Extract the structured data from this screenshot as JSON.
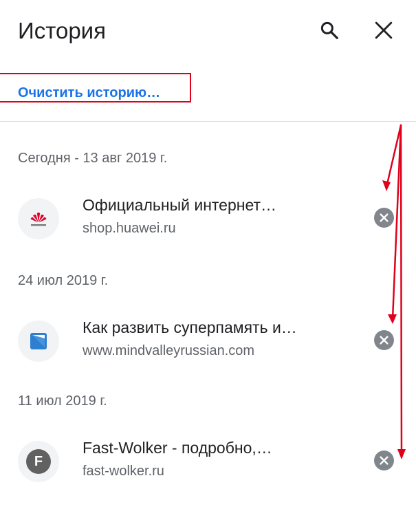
{
  "header": {
    "title": "История",
    "search_icon": "search-icon",
    "close_icon": "close-icon"
  },
  "clear_history_label": "Очистить историю…",
  "colors": {
    "accent": "#1a73e8",
    "annotation_red": "#e0001b",
    "remove_button": "#80868b"
  },
  "groups": [
    {
      "date": "Сегодня - 13 авг 2019 г.",
      "entries": [
        {
          "title": "Официальный интернет…",
          "url": "shop.huawei.ru",
          "icon": "huawei-logo-icon"
        }
      ]
    },
    {
      "date": "24 июл 2019 г.",
      "entries": [
        {
          "title": "Как развить суперпамять и…",
          "url": "www.mindvalleyrussian.com",
          "icon": "mindvalley-logo-icon"
        }
      ]
    },
    {
      "date": "11 июл 2019 г.",
      "entries": [
        {
          "title": "Fast-Wolker - подробно,…",
          "url": "fast-wolker.ru",
          "icon": "letter-f-icon",
          "icon_letter": "F"
        }
      ]
    }
  ]
}
